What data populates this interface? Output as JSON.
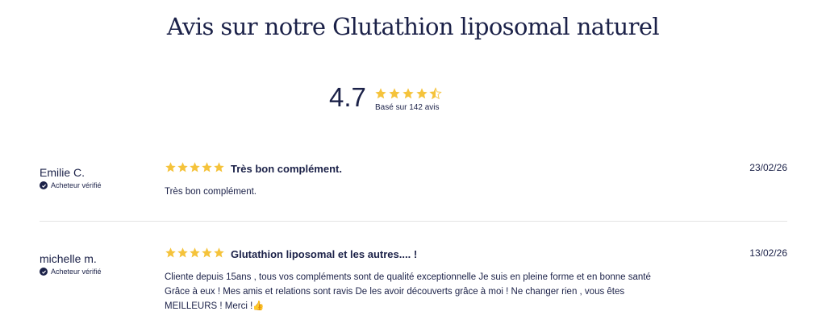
{
  "heading": "Avis sur notre Glutathion liposomal naturel",
  "summary": {
    "average": "4.7",
    "rating": 4.7,
    "based_on": "Basé sur 142 avis"
  },
  "colors": {
    "star": "#f5c33b",
    "star_empty": "#e4e4e4",
    "text": "#1b2148"
  },
  "reviews": [
    {
      "author": "Emilie C.",
      "verified_label": "Acheteur vérifié",
      "rating": 5,
      "title": "Très bon complément.",
      "date": "23/02/26",
      "body": "Très bon complément."
    },
    {
      "author": "michelle m.",
      "verified_label": "Acheteur vérifié",
      "rating": 5,
      "title": "Glutathion liposomal et les autres.... !",
      "date": "13/02/26",
      "body": "Cliente depuis 15ans , tous vos compléments sont de qualité exceptionnelle Je suis en pleine forme et en bonne santé Grâce à eux ! Mes amis et relations sont ravis De les avoir découverts grâce à moi ! Ne changer rien , vous êtes MEILLEURS ! Merci !👍"
    }
  ]
}
